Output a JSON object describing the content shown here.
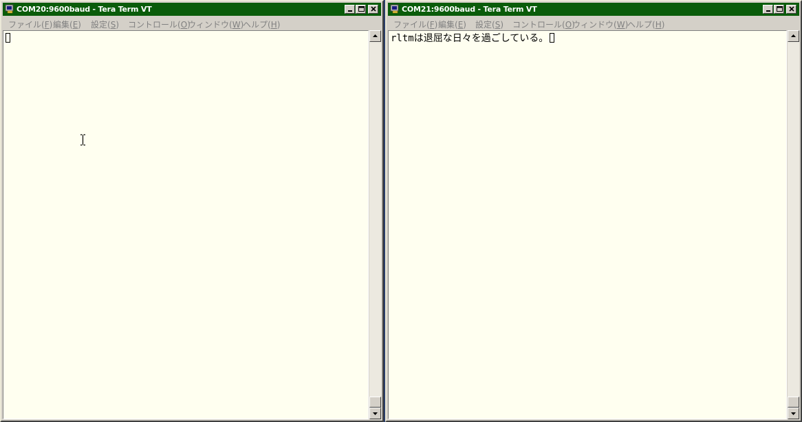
{
  "windows": [
    {
      "title": "COM20:9600baud - Tera Term VT",
      "terminal_text": "",
      "active": false
    },
    {
      "title": "COM21:9600baud - Tera Term VT",
      "terminal_text": "rltmは退屈な日々を過ごしている。",
      "active": true
    }
  ],
  "menu": {
    "file": {
      "label": "ファイル(",
      "key": "F",
      "end": ")"
    },
    "edit": {
      "label": "編集(",
      "key": "E",
      "end": ")"
    },
    "setup": {
      "label": "設定(",
      "key": "S",
      "end": ")"
    },
    "control": {
      "label": "コントロール(",
      "key": "O",
      "end": ")"
    },
    "window": {
      "label": "ウィンドウ(",
      "key": "W",
      "end": ")"
    },
    "help": {
      "label": "ヘルプ(",
      "key": "H",
      "end": ")"
    }
  },
  "icons": {
    "app": "teraterm-icon",
    "minimize": "minimize-icon",
    "maximize": "maximize-icon",
    "close": "close-icon",
    "scroll_up": "scroll-up-arrow-icon",
    "scroll_down": "scroll-down-arrow-icon",
    "mouse_cursor": "text-ibeam-cursor-icon"
  },
  "colors": {
    "titlebar": "#0a5c0a",
    "terminal_bg": "#fffff0",
    "menu_text_disabled": "#808080",
    "window_frame": "#d4d0c8"
  }
}
